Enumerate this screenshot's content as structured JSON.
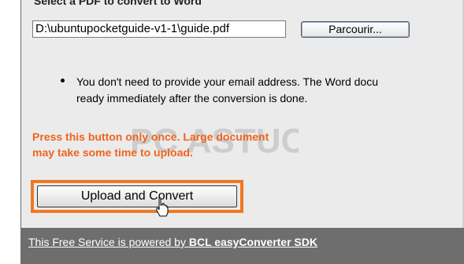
{
  "form": {
    "section_title": "Select a PDF to convert to Word",
    "file_path": "D:\\ubuntupocketguide-v1-1\\guide.pdf",
    "browse_label": "Parcourir...",
    "bullet_line1": "You don't need to provide your email address. The Word docu",
    "bullet_line2": "ready immediately after the conversion is done.",
    "warning_line1": "Press this button only once. Large document",
    "warning_line2": "may take some time to upload.",
    "upload_label": "Upload and Convert"
  },
  "watermark": {
    "text": "PC ASTUCES"
  },
  "footer": {
    "prefix": "This Free Service is powered by ",
    "brand": "BCL easyConverter SDK"
  },
  "colors": {
    "accent": "#f07820",
    "warning": "#f0641e",
    "panel_bg": "#ebebeb",
    "footer_bg": "#6e6e6e"
  },
  "icons": {
    "cursor": "hand-pointer-icon"
  }
}
